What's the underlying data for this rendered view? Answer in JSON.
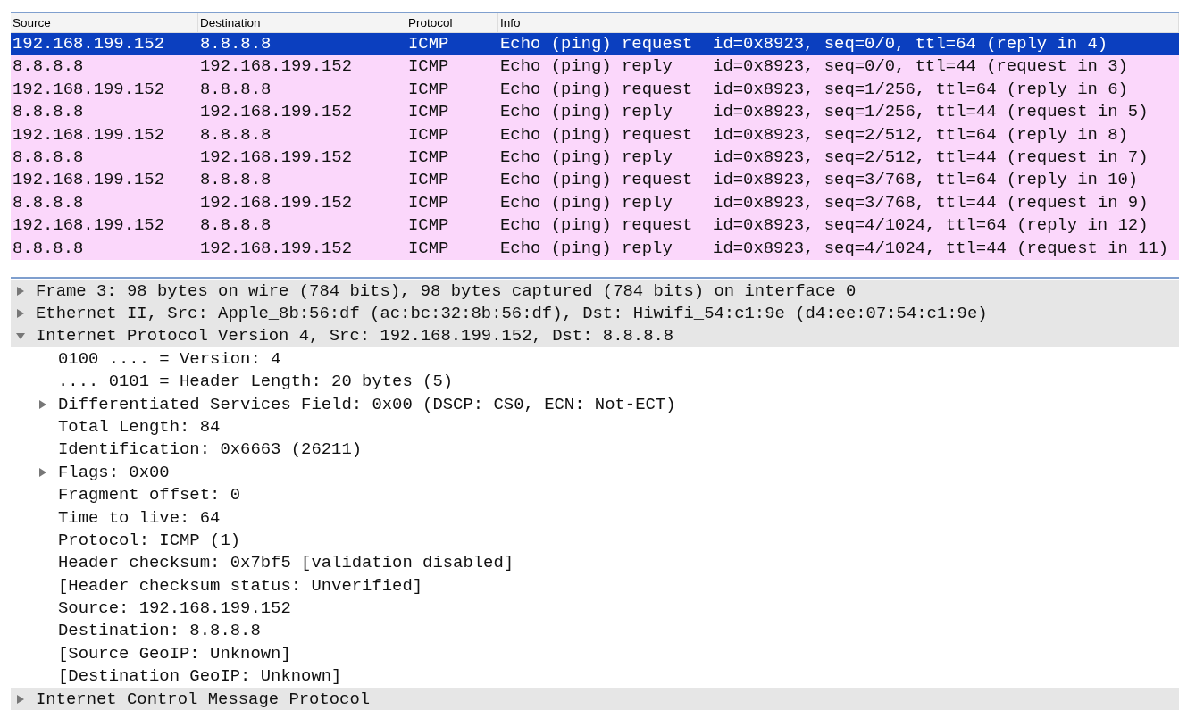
{
  "packet_list": {
    "columns": [
      "Source",
      "Destination",
      "Protocol",
      "Info"
    ],
    "rows": [
      {
        "selected": true,
        "cells": [
          "192.168.199.152",
          "8.8.8.8",
          "ICMP",
          "Echo (ping) request  id=0x8923, seq=0/0, ttl=64 (reply in 4)"
        ]
      },
      {
        "selected": false,
        "cells": [
          "8.8.8.8",
          "192.168.199.152",
          "ICMP",
          "Echo (ping) reply    id=0x8923, seq=0/0, ttl=44 (request in 3)"
        ]
      },
      {
        "selected": false,
        "cells": [
          "192.168.199.152",
          "8.8.8.8",
          "ICMP",
          "Echo (ping) request  id=0x8923, seq=1/256, ttl=64 (reply in 6)"
        ]
      },
      {
        "selected": false,
        "cells": [
          "8.8.8.8",
          "192.168.199.152",
          "ICMP",
          "Echo (ping) reply    id=0x8923, seq=1/256, ttl=44 (request in 5)"
        ]
      },
      {
        "selected": false,
        "cells": [
          "192.168.199.152",
          "8.8.8.8",
          "ICMP",
          "Echo (ping) request  id=0x8923, seq=2/512, ttl=64 (reply in 8)"
        ]
      },
      {
        "selected": false,
        "cells": [
          "8.8.8.8",
          "192.168.199.152",
          "ICMP",
          "Echo (ping) reply    id=0x8923, seq=2/512, ttl=44 (request in 7)"
        ]
      },
      {
        "selected": false,
        "cells": [
          "192.168.199.152",
          "8.8.8.8",
          "ICMP",
          "Echo (ping) request  id=0x8923, seq=3/768, ttl=64 (reply in 10)"
        ]
      },
      {
        "selected": false,
        "cells": [
          "8.8.8.8",
          "192.168.199.152",
          "ICMP",
          "Echo (ping) reply    id=0x8923, seq=3/768, ttl=44 (request in 9)"
        ]
      },
      {
        "selected": false,
        "cells": [
          "192.168.199.152",
          "8.8.8.8",
          "ICMP",
          "Echo (ping) request  id=0x8923, seq=4/1024, ttl=64 (reply in 12)"
        ]
      },
      {
        "selected": false,
        "cells": [
          "8.8.8.8",
          "192.168.199.152",
          "ICMP",
          "Echo (ping) reply    id=0x8923, seq=4/1024, ttl=44 (request in 11)"
        ]
      }
    ]
  },
  "packet_details": [
    {
      "label": "Frame 3: 98 bytes on wire (784 bits), 98 bytes captured (784 bits) on interface 0",
      "expanded": false
    },
    {
      "label": "Ethernet II, Src: Apple_8b:56:df (ac:bc:32:8b:56:df), Dst: Hiwifi_54:c1:9e (d4:ee:07:54:c1:9e)",
      "expanded": false
    },
    {
      "label": "Internet Protocol Version 4, Src: 192.168.199.152, Dst: 8.8.8.8",
      "expanded": true,
      "children": [
        {
          "label": "0100 .... = Version: 4"
        },
        {
          "label": ".... 0101 = Header Length: 20 bytes (5)"
        },
        {
          "label": "Differentiated Services Field: 0x00 (DSCP: CS0, ECN: Not-ECT)",
          "expanded": false
        },
        {
          "label": "Total Length: 84"
        },
        {
          "label": "Identification: 0x6663 (26211)"
        },
        {
          "label": "Flags: 0x00",
          "expanded": false
        },
        {
          "label": "Fragment offset: 0"
        },
        {
          "label": "Time to live: 64"
        },
        {
          "label": "Protocol: ICMP (1)"
        },
        {
          "label": "Header checksum: 0x7bf5 [validation disabled]"
        },
        {
          "label": "[Header checksum status: Unverified]"
        },
        {
          "label": "Source: 192.168.199.152"
        },
        {
          "label": "Destination: 8.8.8.8"
        },
        {
          "label": "[Source GeoIP: Unknown]"
        },
        {
          "label": "[Destination GeoIP: Unknown]"
        }
      ]
    },
    {
      "label": "Internet Control Message Protocol",
      "expanded": false
    }
  ]
}
